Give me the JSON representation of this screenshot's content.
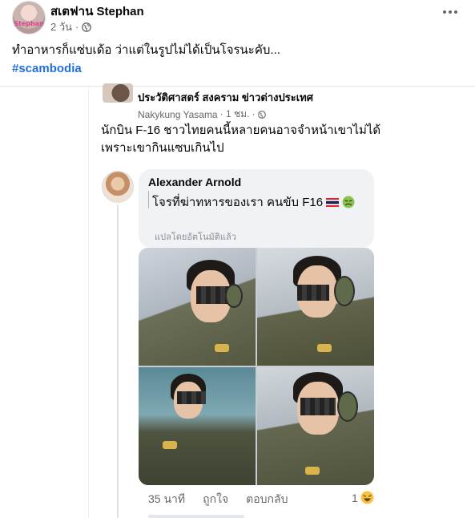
{
  "post": {
    "author": "สเตฟาน Stephan",
    "avatar_caption": "Stephan",
    "time": "2 วัน",
    "audience_icon": "globe-icon",
    "text": "ทำอาหารก็แซ่บเด้อ ว่าแต่ในรูปไม่ได้เป็นโจรนะคับ...",
    "hashtag": "#scambodia",
    "more_icon": "more-icon"
  },
  "shared": {
    "page_name": "ประวัติศาสตร์ สงคราม ข่าวต่างประเทศ",
    "poster": "Nakykung Yasama",
    "poster_time": "· 1 ชม. ·",
    "text_lines": [
      "นักบิน F-16 ชาวไทยคนนี้หลายคนอาจจำหน้าเขาไม่ได้",
      "เพราะเขากินแซบเกินไป"
    ]
  },
  "comment": {
    "author": "Alexander Arnold",
    "text": "โจรที่ฆ่าทหารของเรา คนขับ F16",
    "emojis": [
      "flag-thailand-icon",
      "nauseated-face-icon"
    ],
    "translated_note": "แปลโดยอัตโนมัติแล้ว",
    "time": "35 นาที",
    "like_label": "ถูกใจ",
    "reply_label": "ตอบกลับ",
    "reaction_count": "1",
    "reaction_icon": "laughing-face-icon"
  },
  "colors": {
    "link": "#216fdb",
    "secondary_text": "#65676b",
    "bubble": "#f0f2f5"
  }
}
